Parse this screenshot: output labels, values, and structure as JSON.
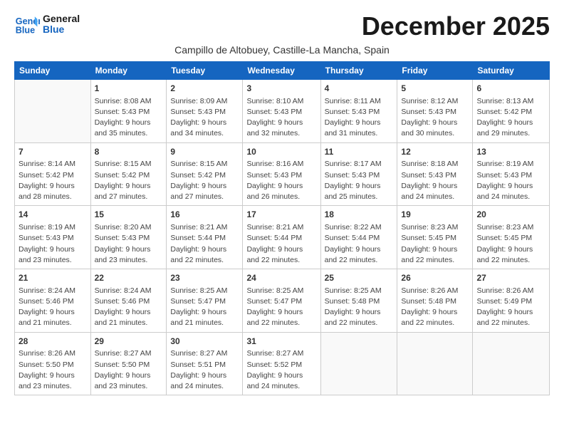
{
  "logo": {
    "line1": "General",
    "line2": "Blue"
  },
  "title": "December 2025",
  "location": "Campillo de Altobuey, Castille-La Mancha, Spain",
  "days_of_week": [
    "Sunday",
    "Monday",
    "Tuesday",
    "Wednesday",
    "Thursday",
    "Friday",
    "Saturday"
  ],
  "weeks": [
    [
      {
        "day": "",
        "info": ""
      },
      {
        "day": "1",
        "info": "Sunrise: 8:08 AM\nSunset: 5:43 PM\nDaylight: 9 hours\nand 35 minutes."
      },
      {
        "day": "2",
        "info": "Sunrise: 8:09 AM\nSunset: 5:43 PM\nDaylight: 9 hours\nand 34 minutes."
      },
      {
        "day": "3",
        "info": "Sunrise: 8:10 AM\nSunset: 5:43 PM\nDaylight: 9 hours\nand 32 minutes."
      },
      {
        "day": "4",
        "info": "Sunrise: 8:11 AM\nSunset: 5:43 PM\nDaylight: 9 hours\nand 31 minutes."
      },
      {
        "day": "5",
        "info": "Sunrise: 8:12 AM\nSunset: 5:43 PM\nDaylight: 9 hours\nand 30 minutes."
      },
      {
        "day": "6",
        "info": "Sunrise: 8:13 AM\nSunset: 5:42 PM\nDaylight: 9 hours\nand 29 minutes."
      }
    ],
    [
      {
        "day": "7",
        "info": "Sunrise: 8:14 AM\nSunset: 5:42 PM\nDaylight: 9 hours\nand 28 minutes."
      },
      {
        "day": "8",
        "info": "Sunrise: 8:15 AM\nSunset: 5:42 PM\nDaylight: 9 hours\nand 27 minutes."
      },
      {
        "day": "9",
        "info": "Sunrise: 8:15 AM\nSunset: 5:42 PM\nDaylight: 9 hours\nand 27 minutes."
      },
      {
        "day": "10",
        "info": "Sunrise: 8:16 AM\nSunset: 5:43 PM\nDaylight: 9 hours\nand 26 minutes."
      },
      {
        "day": "11",
        "info": "Sunrise: 8:17 AM\nSunset: 5:43 PM\nDaylight: 9 hours\nand 25 minutes."
      },
      {
        "day": "12",
        "info": "Sunrise: 8:18 AM\nSunset: 5:43 PM\nDaylight: 9 hours\nand 24 minutes."
      },
      {
        "day": "13",
        "info": "Sunrise: 8:19 AM\nSunset: 5:43 PM\nDaylight: 9 hours\nand 24 minutes."
      }
    ],
    [
      {
        "day": "14",
        "info": "Sunrise: 8:19 AM\nSunset: 5:43 PM\nDaylight: 9 hours\nand 23 minutes."
      },
      {
        "day": "15",
        "info": "Sunrise: 8:20 AM\nSunset: 5:43 PM\nDaylight: 9 hours\nand 23 minutes."
      },
      {
        "day": "16",
        "info": "Sunrise: 8:21 AM\nSunset: 5:44 PM\nDaylight: 9 hours\nand 22 minutes."
      },
      {
        "day": "17",
        "info": "Sunrise: 8:21 AM\nSunset: 5:44 PM\nDaylight: 9 hours\nand 22 minutes."
      },
      {
        "day": "18",
        "info": "Sunrise: 8:22 AM\nSunset: 5:44 PM\nDaylight: 9 hours\nand 22 minutes."
      },
      {
        "day": "19",
        "info": "Sunrise: 8:23 AM\nSunset: 5:45 PM\nDaylight: 9 hours\nand 22 minutes."
      },
      {
        "day": "20",
        "info": "Sunrise: 8:23 AM\nSunset: 5:45 PM\nDaylight: 9 hours\nand 22 minutes."
      }
    ],
    [
      {
        "day": "21",
        "info": "Sunrise: 8:24 AM\nSunset: 5:46 PM\nDaylight: 9 hours\nand 21 minutes."
      },
      {
        "day": "22",
        "info": "Sunrise: 8:24 AM\nSunset: 5:46 PM\nDaylight: 9 hours\nand 21 minutes."
      },
      {
        "day": "23",
        "info": "Sunrise: 8:25 AM\nSunset: 5:47 PM\nDaylight: 9 hours\nand 21 minutes."
      },
      {
        "day": "24",
        "info": "Sunrise: 8:25 AM\nSunset: 5:47 PM\nDaylight: 9 hours\nand 22 minutes."
      },
      {
        "day": "25",
        "info": "Sunrise: 8:25 AM\nSunset: 5:48 PM\nDaylight: 9 hours\nand 22 minutes."
      },
      {
        "day": "26",
        "info": "Sunrise: 8:26 AM\nSunset: 5:48 PM\nDaylight: 9 hours\nand 22 minutes."
      },
      {
        "day": "27",
        "info": "Sunrise: 8:26 AM\nSunset: 5:49 PM\nDaylight: 9 hours\nand 22 minutes."
      }
    ],
    [
      {
        "day": "28",
        "info": "Sunrise: 8:26 AM\nSunset: 5:50 PM\nDaylight: 9 hours\nand 23 minutes."
      },
      {
        "day": "29",
        "info": "Sunrise: 8:27 AM\nSunset: 5:50 PM\nDaylight: 9 hours\nand 23 minutes."
      },
      {
        "day": "30",
        "info": "Sunrise: 8:27 AM\nSunset: 5:51 PM\nDaylight: 9 hours\nand 24 minutes."
      },
      {
        "day": "31",
        "info": "Sunrise: 8:27 AM\nSunset: 5:52 PM\nDaylight: 9 hours\nand 24 minutes."
      },
      {
        "day": "",
        "info": ""
      },
      {
        "day": "",
        "info": ""
      },
      {
        "day": "",
        "info": ""
      }
    ]
  ]
}
